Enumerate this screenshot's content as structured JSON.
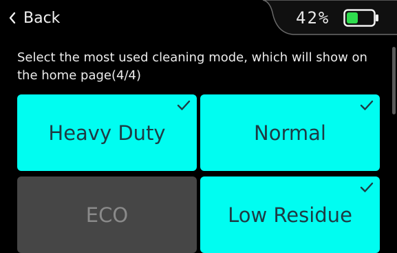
{
  "header": {
    "back_label": "Back",
    "battery_percent": "42%",
    "battery_level": 0.42,
    "battery_color": "#2fdc4e"
  },
  "prompt": "Select the most used cleaning mode, which will show on the home page(4/4)",
  "modes": [
    {
      "label": "Heavy Duty",
      "selected": true
    },
    {
      "label": "Normal",
      "selected": true
    },
    {
      "label": "ECO",
      "selected": false
    },
    {
      "label": "Low Residue",
      "selected": true
    }
  ],
  "colors": {
    "selected": "#00fdf1",
    "unselected": "#464646",
    "selected_text": "#1e3b44",
    "unselected_text": "#8a8a8a"
  },
  "icons": {
    "back": "chevron-left-icon",
    "battery": "battery-icon",
    "check": "checkmark-icon"
  }
}
